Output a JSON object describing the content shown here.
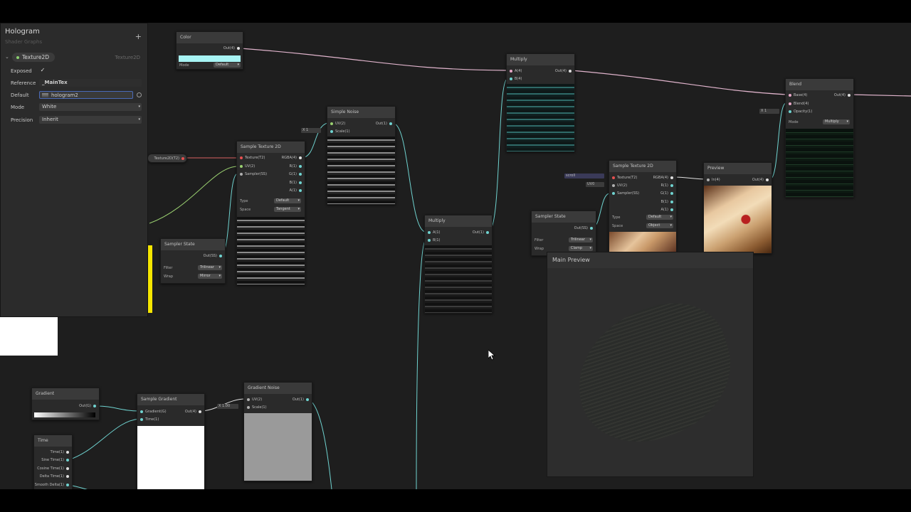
{
  "blackboard": {
    "title": "Hologram",
    "subtitle": "Shader Graphs",
    "add_label": "+",
    "property": {
      "name": "Texture2D",
      "type": "Texture2D"
    },
    "exposed_label": "Exposed",
    "exposed_value": "✓",
    "reference_label": "Reference",
    "reference_value": "_MainTex",
    "default_label": "Default",
    "default_value": "hologram2",
    "mode_label": "Mode",
    "mode_value": "White",
    "precision_label": "Precision",
    "precision_value": "Inherit"
  },
  "nodes": {
    "color": {
      "title": "Color",
      "out": "Out(4)",
      "mode_label": "Mode",
      "mode_value": "Default",
      "swatch": "#a8f4f4"
    },
    "sample_tex_1": {
      "title": "Sample Texture 2D",
      "inputs": [
        "Texture(T2)",
        "UV(2)",
        "Sampler(SS)"
      ],
      "outputs": [
        "RGBA(4)",
        "R(1)",
        "G(1)",
        "B(1)",
        "A(1)"
      ],
      "type_label": "Type",
      "type_value": "Default",
      "space_label": "Space",
      "space_value": "Tangent"
    },
    "texture_prop": {
      "label": "Texture2D(T2)"
    },
    "simple_noise": {
      "title": "Simple Noise",
      "inputs": [
        "UV(2)",
        "Scale(1)"
      ],
      "output": "Out(1)",
      "scale_field": "X  1"
    },
    "multiply_1": {
      "title": "Multiply",
      "inputs": [
        "A(4)",
        "B(4)"
      ],
      "output": "Out(4)"
    },
    "multiply_2": {
      "title": "Multiply",
      "inputs": [
        "A(1)",
        "B(1)"
      ],
      "output": "Out(1)"
    },
    "sampler_1": {
      "title": "Sampler State",
      "output": "Out(SS)",
      "filter_label": "Filter",
      "filter_value": "Trilinear",
      "wrap_label": "Wrap",
      "wrap_value": "Mirror"
    },
    "sampler_2": {
      "title": "Sampler State",
      "output": "Out(SS)",
      "filter_label": "Filter",
      "filter_value": "Trilinear",
      "wrap_label": "Wrap",
      "wrap_value": "Clamp"
    },
    "sample_tex_2": {
      "title": "Sample Texture 2D",
      "inputs": [
        "Texture(T2)",
        "UV(2)",
        "Sampler(SS)"
      ],
      "outputs": [
        "RGBA(4)",
        "R(1)",
        "G(1)",
        "B(1)",
        "A(1)"
      ],
      "type_label": "Type",
      "type_value": "Default",
      "space_label": "Space",
      "space_value": "Object",
      "tex_field": "scroll",
      "uv_field": "UV0"
    },
    "preview": {
      "title": "Preview",
      "input": "In(4)",
      "output": "Out(4)"
    },
    "blend": {
      "title": "Blend",
      "inputs": [
        "Base(4)",
        "Blend(4)",
        "Opacity(1)"
      ],
      "output": "Out(4)",
      "mode_label": "Mode",
      "mode_value": "Multiply",
      "opacity_field": "X  1"
    },
    "gradient": {
      "title": "Gradient",
      "output": "Out(G)"
    },
    "sample_gradient": {
      "title": "Sample Gradient",
      "inputs": [
        "Gradient(G)",
        "Time(1)"
      ],
      "output": "Out(4)"
    },
    "gradient_noise": {
      "title": "Gradient Noise",
      "inputs": [
        "UV(2)",
        "Scale(1)"
      ],
      "output": "Out(1)",
      "scale_field": "X  1.00"
    },
    "time": {
      "title": "Time",
      "outputs": [
        "Time(1)",
        "Sine Time(1)",
        "Cosine Time(1)",
        "Delta Time(1)",
        "Smooth Delta(1)"
      ]
    }
  },
  "main_preview": {
    "title": "Main Preview"
  },
  "colors": {
    "canvas": "#1e1e1e",
    "node": "#2a2a2a",
    "wire_pink": "#e0b4cc",
    "wire_cyan": "#6fd3d0",
    "wire_green": "#9ad070",
    "wire_red": "#d86060",
    "yellow": "#f5e600"
  }
}
